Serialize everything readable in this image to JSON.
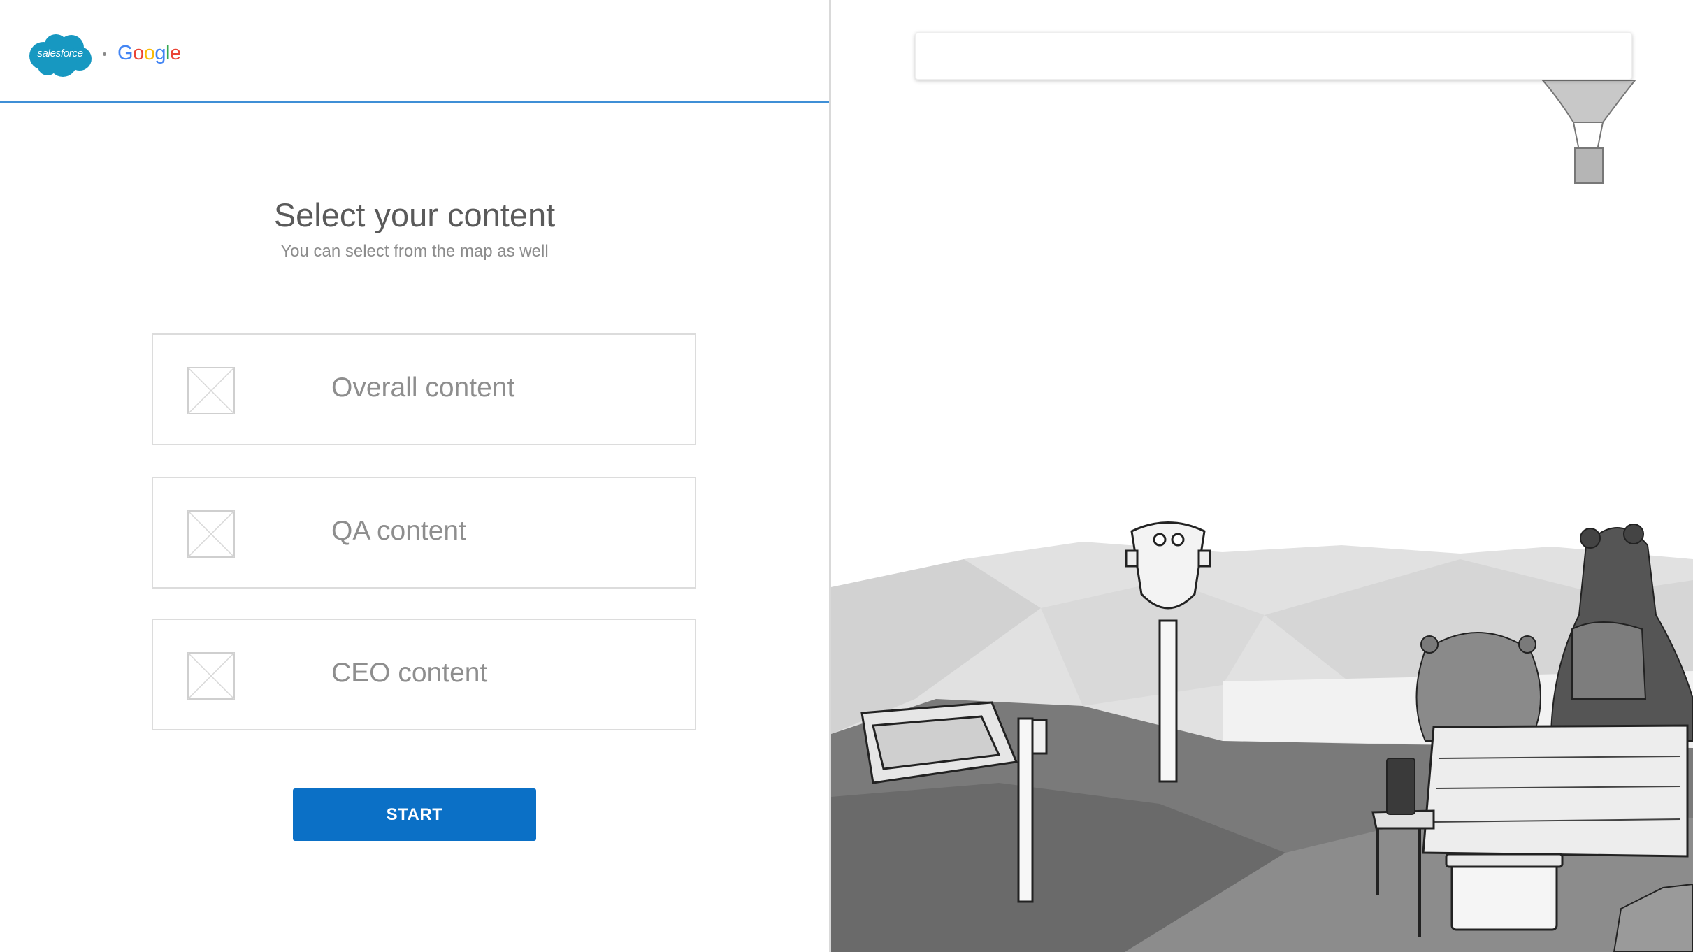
{
  "header": {
    "salesforce_logo_text": "salesforce",
    "separator": "·",
    "google_logo": [
      "G",
      "o",
      "o",
      "g",
      "l",
      "e"
    ],
    "google_colors": [
      "#4285F4",
      "#EA4335",
      "#FBBC05",
      "#4285F4",
      "#34A853",
      "#EA4335"
    ]
  },
  "main": {
    "title": "Select your content",
    "subtitle": "You can select from the map as well",
    "options": [
      {
        "label": "Overall content"
      },
      {
        "label": "QA content"
      },
      {
        "label": "CEO content"
      }
    ],
    "start_label": "START"
  },
  "map": {
    "search_value": ""
  },
  "colors": {
    "accent": "#0b70c6",
    "header_rule": "#3f8fd6",
    "salesforce_blue": "#1798c1"
  }
}
